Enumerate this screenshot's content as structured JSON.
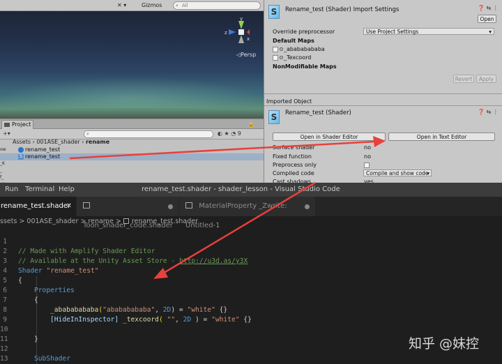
{
  "scene": {
    "toolbar_tools": "✕ ▾",
    "gizmos_label": "Gizmos",
    "search_placeholder": "All",
    "persp_label": "◁Persp",
    "axis_labels": [
      "y",
      "z",
      "x"
    ]
  },
  "project_panel": {
    "tab_label": "Project",
    "toolbar_icons": "◐ ★ ◔ 9",
    "breadcrumb": [
      "Assets",
      "001ASE_shader",
      "rename"
    ],
    "breadcrumb_sep": "›",
    "items": [
      {
        "name": "rename_test",
        "icon": "material-icon",
        "selected": false
      },
      {
        "name": "rename_test",
        "icon": "shader-icon",
        "selected": true
      }
    ],
    "left_strip": [
      "ow",
      "E_",
      "_K",
      "_",
      "f_",
      "_Y"
    ]
  },
  "inspector": {
    "shader_glyph": "S",
    "title": "Rename_test (Shader) Import Settings",
    "open_button": "Open",
    "header_icons": "❓ ⇆ ⋮",
    "override_label": "Override preprocessor",
    "override_value": "Use Project Settings",
    "default_maps_label": "Default Maps",
    "default_maps": [
      "_abababababa",
      "_Texcoord"
    ],
    "nonmodifiable_label": "NonModifiable Maps",
    "revert_button": "Revert",
    "apply_button": "Apply",
    "imported_object_label": "Imported Object",
    "object_title": "Rename_test (Shader)",
    "open_shader_editor": "Open in Shader Editor",
    "open_text_editor": "Open in Text Editor",
    "props": [
      {
        "label": "Surface shader",
        "value": "no"
      },
      {
        "label": "Fixed function",
        "value": "no"
      },
      {
        "label": "Preprocess only",
        "value": ""
      },
      {
        "label": "Compiled code",
        "value": "Compile and show code"
      }
    ],
    "cut_row_label": "Cast shadows",
    "cut_row_value": "yes"
  },
  "vscode": {
    "menu": [
      "Run",
      "Terminal",
      "Help"
    ],
    "window_title": "rename_test.shader - shader_lesson - Visual Studio Code",
    "tabs": [
      {
        "label": "rename_test.shader",
        "active": true,
        "marker": "✕"
      },
      {
        "label": "Toon_shader_code.shader",
        "active": false,
        "marker": "●"
      },
      {
        "label": "MaterialProperty _Zwrite: Untitled-1",
        "active": false,
        "marker": "●"
      }
    ],
    "breadcrumbs": [
      "ssets",
      "001ASE_shader",
      "rename",
      "rename_test.shader"
    ],
    "crumb_sep": " > ",
    "line_numbers": [
      "1",
      "2",
      "3",
      "4",
      "5",
      "6",
      "7",
      "8",
      "9",
      "10",
      "11",
      "12",
      "13"
    ],
    "code": {
      "l1": "// Made with Amplify Shader Editor",
      "l2_text": "// Available at the Unity Asset Store - ",
      "l2_link": "http://u3d.as/y3X",
      "l3_kw": "Shader",
      "l3_str": "\"rename_test\"",
      "l4": "{",
      "l5": "Properties",
      "l6": "{",
      "l7_name": "_abababababa",
      "l7_open": "(",
      "l7_str": "\"abababababa\"",
      "l7_mid": ", ",
      "l7_2d": "2D",
      "l7_close": ") = ",
      "l7_val": "\"white\"",
      "l7_end": " {}",
      "l8_attr": "[HideInInspector] ",
      "l8_name": "_texcoord",
      "l8_open": "( ",
      "l8_str": "\"\"",
      "l8_mid": ", ",
      "l8_2d": "2D",
      "l8_close": " ) = ",
      "l8_val": "\"white\"",
      "l8_end": " {}",
      "l10": "}",
      "l12": "SubShader",
      "l13": "{"
    }
  },
  "watermark": "知乎 @妹控",
  "colors": {
    "annotation_arrow": "#e8403a",
    "vscode_bg": "#1e1e1e",
    "unity_panel": "#c8c8c8"
  }
}
